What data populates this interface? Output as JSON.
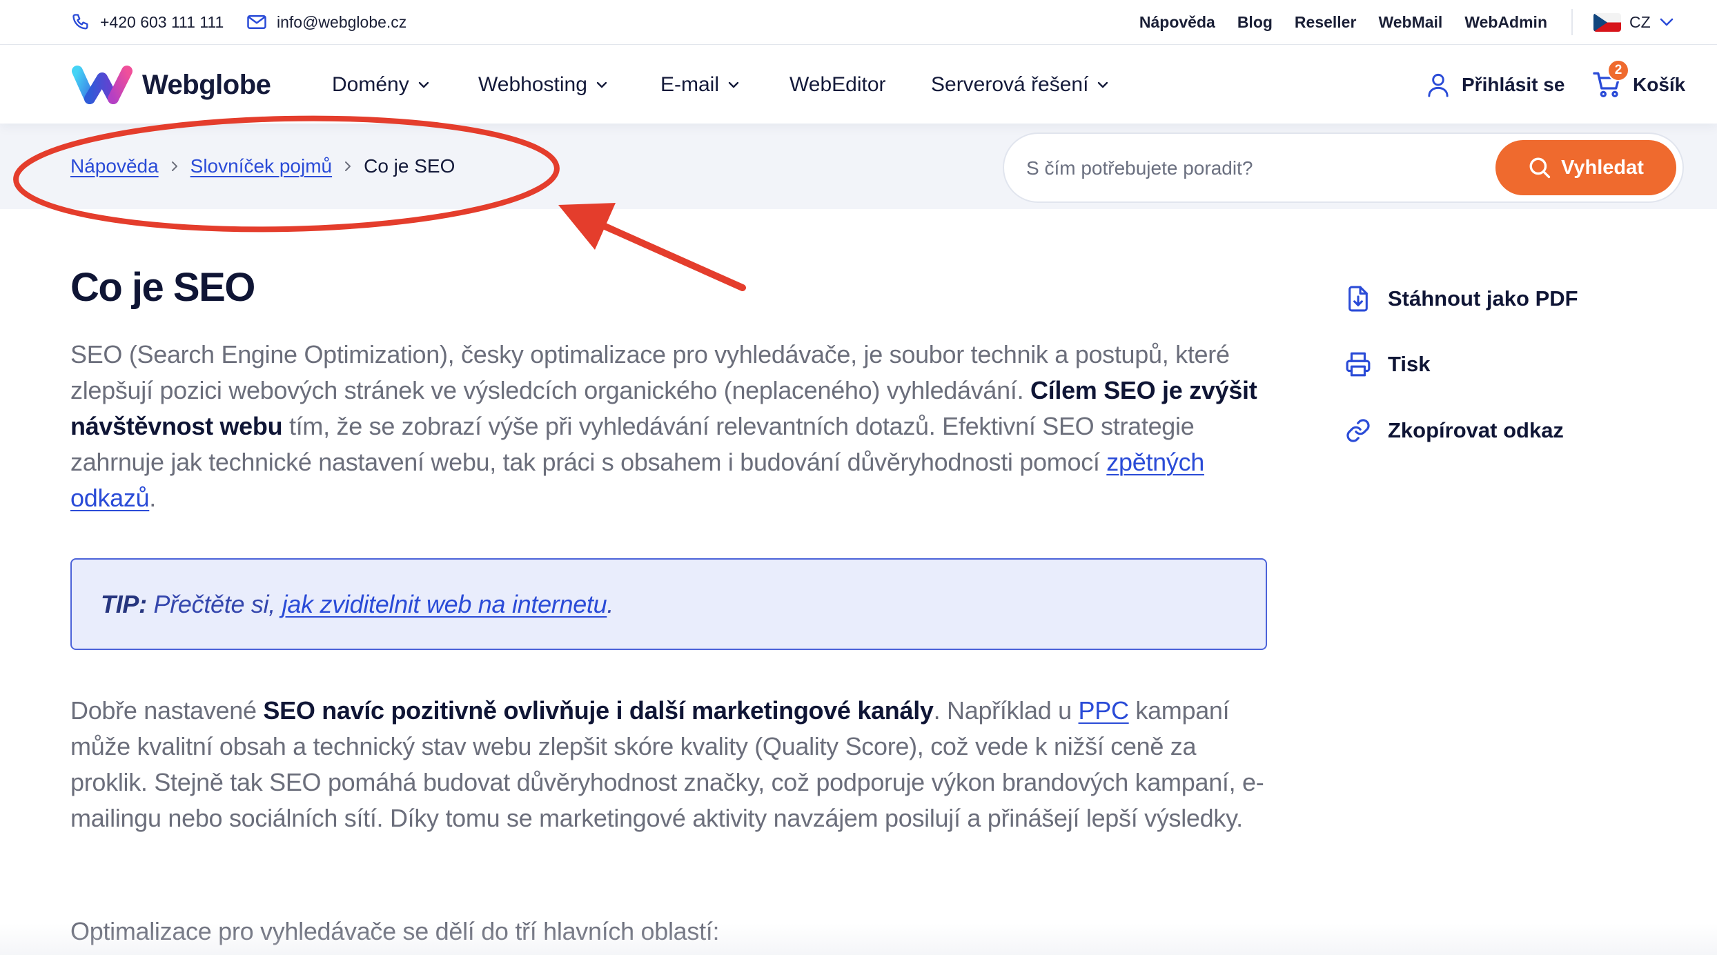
{
  "topbar": {
    "phone": "+420 603 111 111",
    "email": "info@webglobe.cz",
    "links": [
      "Nápověda",
      "Blog",
      "Reseller",
      "WebMail",
      "WebAdmin"
    ],
    "language": "CZ"
  },
  "nav": {
    "logo_text": "Webglobe",
    "items": [
      "Domény",
      "Webhosting",
      "E-mail",
      "WebEditor",
      "Serverová řešení"
    ],
    "login": "Přihlásit se",
    "cart_label": "Košík",
    "cart_count": "2"
  },
  "breadcrumb": {
    "items": [
      "Nápověda",
      "Slovníček pojmů"
    ],
    "current": "Co je SEO"
  },
  "search": {
    "placeholder": "S čím potřebujete poradit?",
    "button": "Vyhledat"
  },
  "article": {
    "title": "Co je SEO",
    "intro": {
      "t1": "SEO (Search Engine Optimization), česky optimalizace pro vyhledávače, je soubor technik a postupů, které zlepšují pozici webových stránek ve výsledcích organického (neplaceného) vyhledávání. ",
      "b1": "Cílem SEO je zvýšit návštěvnost webu",
      "t2": " tím, že se zobrazí výše při vyhledávání relevantních dotazů. Efektivní SEO strategie zahrnuje jak technické nastavení webu, tak práci s obsahem i budování důvěryhodnosti pomocí ",
      "link": "zpětných odkazů",
      "t3": "."
    },
    "tip": {
      "label": "TIP:",
      "text": " Přečtěte si, ",
      "link": "jak zviditelnit web na internetu",
      "end": "."
    },
    "para2": {
      "t1": "Dobře nastavené ",
      "b1": "SEO navíc pozitivně ovlivňuje i další marketingové kanály",
      "t2": ". Například u ",
      "link": "PPC",
      "t3": " kampaní může kvalitní obsah a technický stav webu zlepšit skóre kvality (Quality Score), což vede k nižší ceně za proklik. Stejně tak SEO pomáhá budovat důvěryhodnost značky, což podporuje výkon brandových kampaní, e-mailingu nebo sociálních sítí. Díky tomu se marketingové aktivity navzájem posilují a přinášejí lepší výsledky."
    },
    "para3": "Optimalizace pro vyhledávače se dělí do tří hlavních oblastí:"
  },
  "actions": [
    {
      "label": "Stáhnout jako PDF",
      "icon": "file-download-icon"
    },
    {
      "label": "Tisk",
      "icon": "printer-icon"
    },
    {
      "label": "Zkopírovat odkaz",
      "icon": "link-icon"
    }
  ],
  "colors": {
    "accent": "#2a4bd7",
    "search_button": "#ef6a2e",
    "tip_background": "#e9edfc",
    "annotation": "#e43d2c"
  }
}
